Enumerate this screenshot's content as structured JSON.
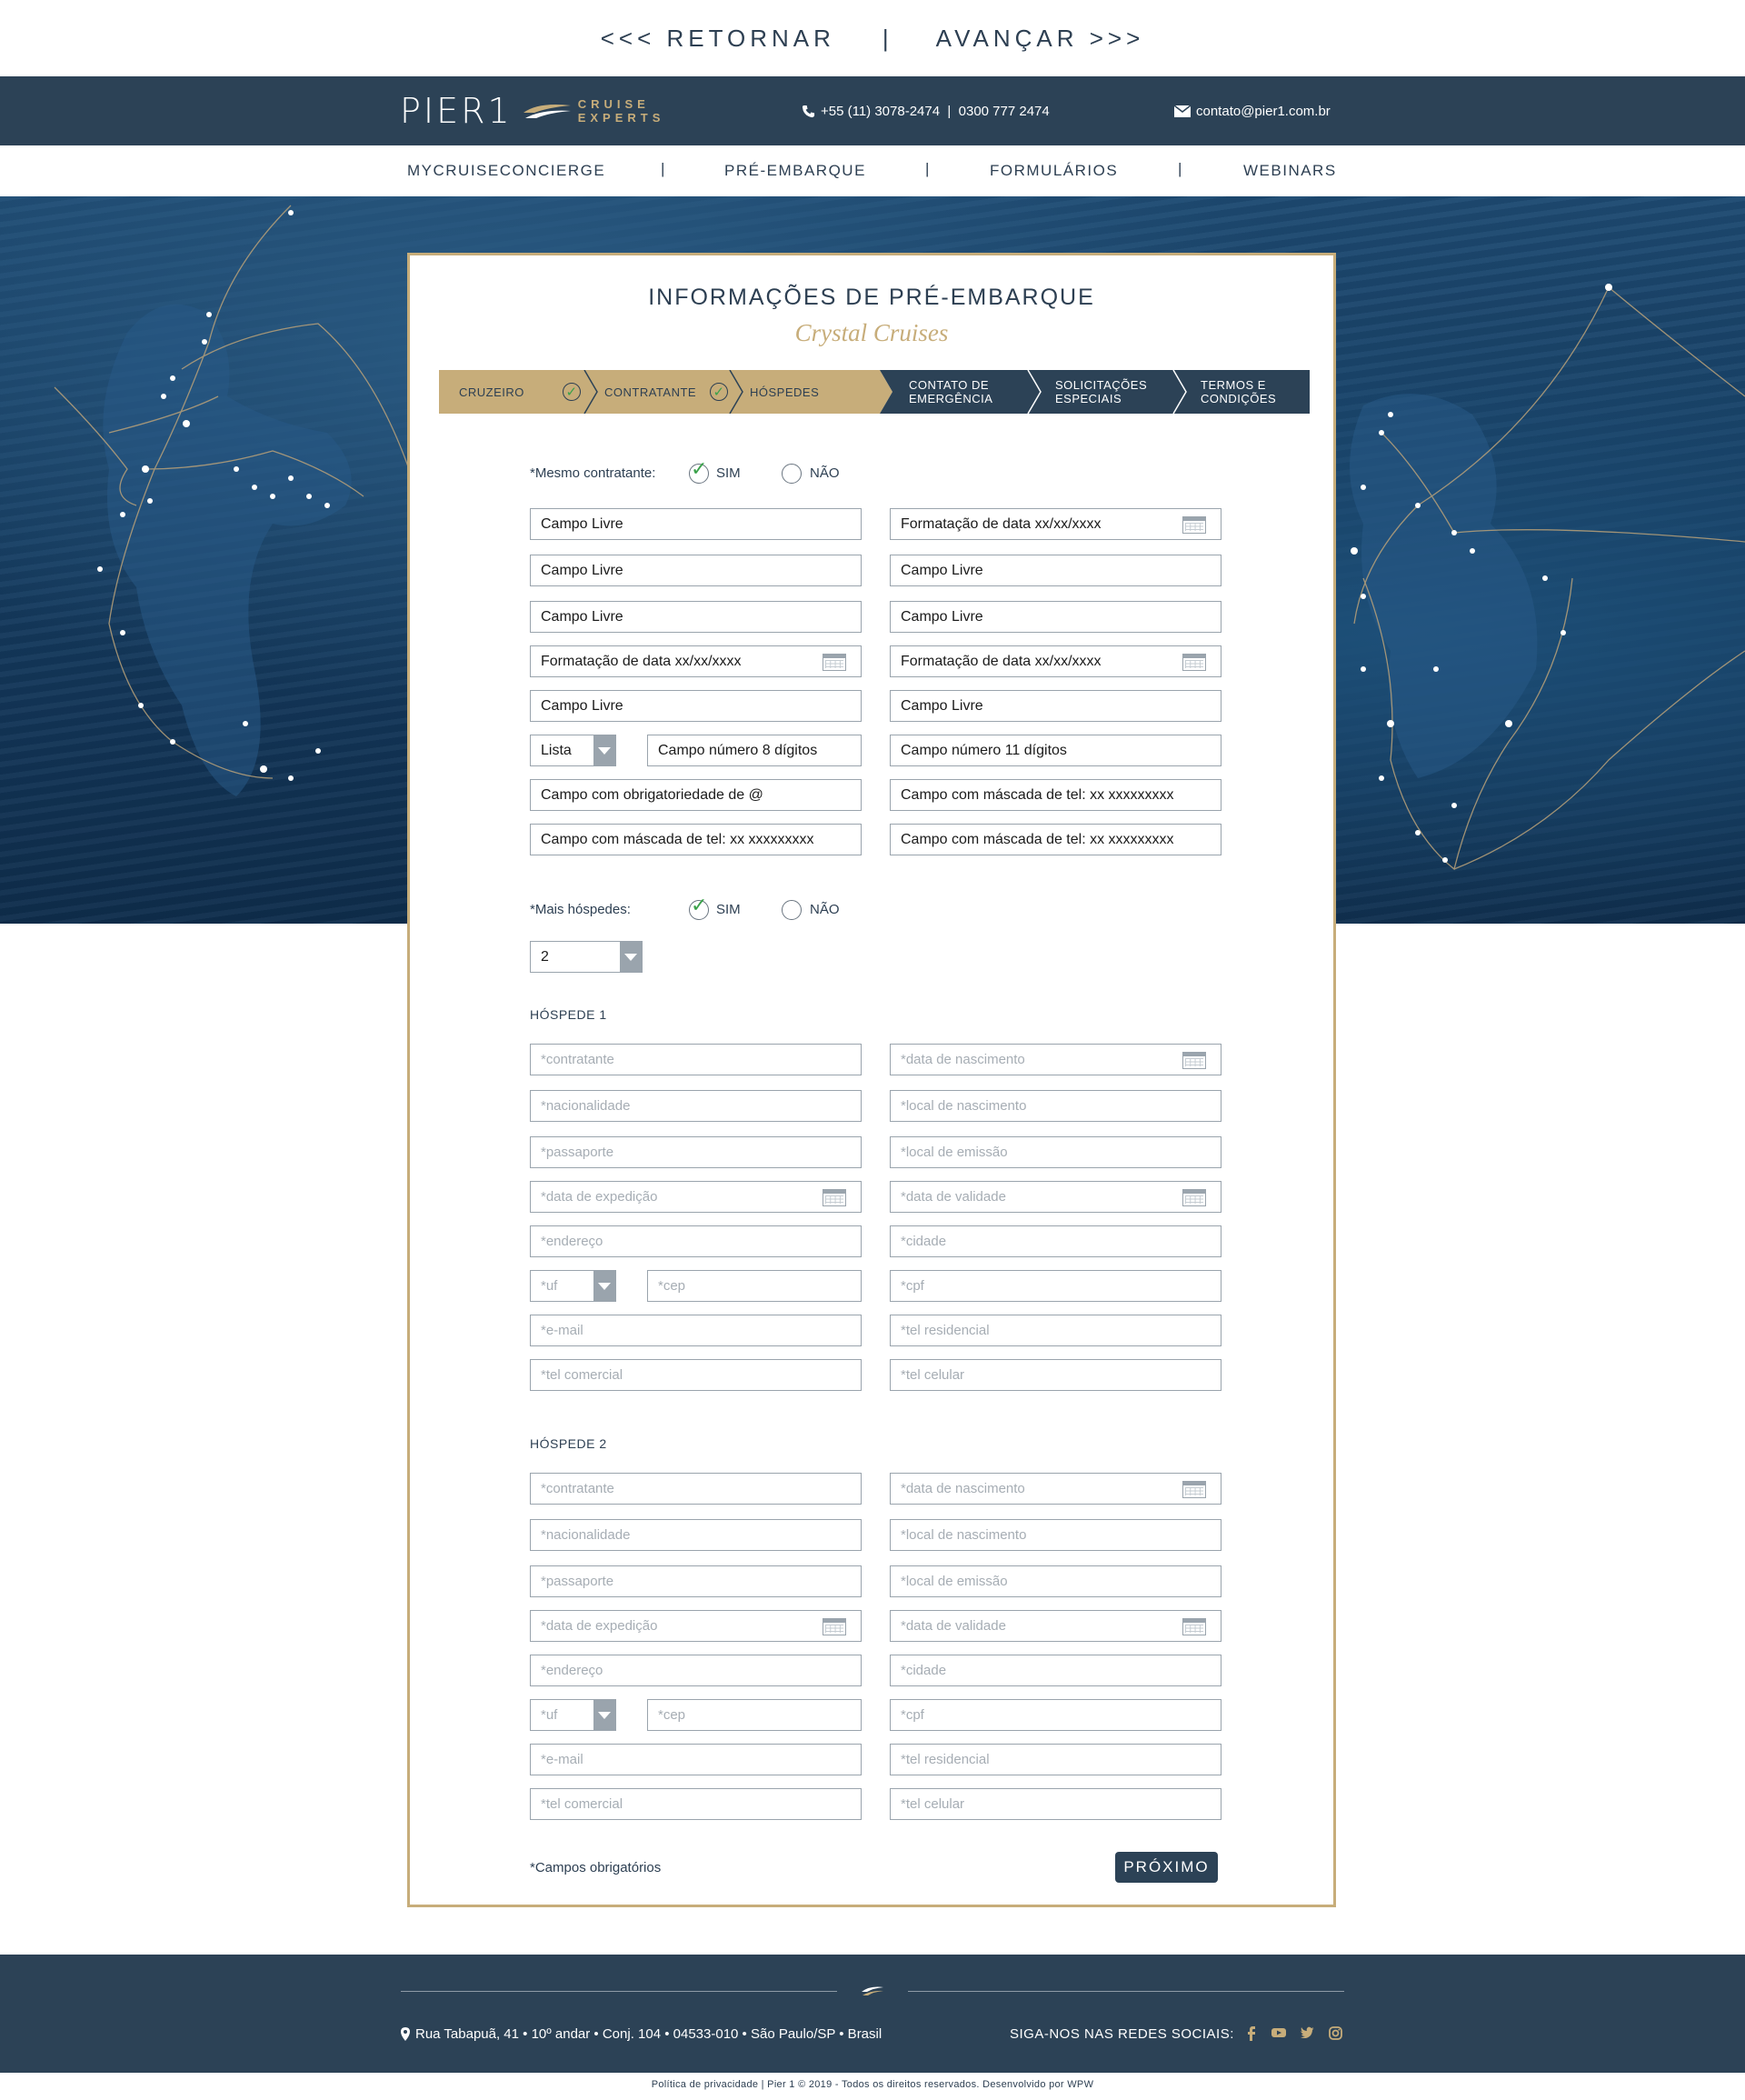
{
  "topnav": {
    "back": "<<< RETORNAR",
    "separator": "|",
    "forward": "AVANÇAR >>>"
  },
  "header": {
    "logo_text": "PIER1",
    "logo_sub1": "CRUISE",
    "logo_sub2": "EXPERTS",
    "phone": "+55 (11) 3078-2474  |  0300 777 2474",
    "email": "contato@pier1.com.br",
    "phone_icon": "phone-icon",
    "mail_icon": "mail-icon"
  },
  "menu": {
    "items": [
      "MYCRUISECONCIERGE",
      "PRÉ-EMBARQUE",
      "FORMULÁRIOS",
      "WEBINARS"
    ],
    "separator": "|"
  },
  "form": {
    "title": "INFORMAÇÕES DE PRÉ-EMBARQUE",
    "subtitle": "Crystal Cruises",
    "steps": [
      {
        "label": "CRUZEIRO",
        "done": true
      },
      {
        "label": "CONTRATANTE",
        "done": true
      },
      {
        "label": "HÓSPEDES",
        "done": false
      },
      {
        "label": "CONTATO DE EMERGÊNCIA",
        "done": false
      },
      {
        "label": "SOLICITAÇÕES ESPECIAIS",
        "done": false
      },
      {
        "label": "TERMOS E CONDIÇÕES",
        "done": false
      }
    ],
    "same_contractor": {
      "label": "*Mesmo contratante:",
      "yes": "SIM",
      "no": "NÃO",
      "selected": "SIM"
    },
    "contractor_fields": {
      "left": [
        "Campo Livre",
        "Campo Livre",
        "Campo Livre",
        "Formatação de data xx/xx/xxxx",
        "Campo Livre"
      ],
      "list": "Lista",
      "number8": "Campo número 8 dígitos",
      "email": "Campo com obrigatoriedade de @",
      "tel_left": "Campo com máscada de tel: xx xxxxxxxxx",
      "right": [
        "Formatação de data xx/xx/xxxx",
        "Campo Livre",
        "Campo Livre",
        "Formatação de data xx/xx/xxxx",
        "Campo Livre",
        "Campo número 11 dígitos",
        "Campo com máscada de tel: xx xxxxxxxxx",
        "Campo com máscada de tel: xx xxxxxxxxx"
      ]
    },
    "more_guests": {
      "label": "*Mais hóspedes:",
      "yes": "SIM",
      "no": "NÃO",
      "selected": "SIM"
    },
    "guest_count": "2",
    "guests": [
      {
        "heading": "HÓSPEDE 1",
        "left": [
          "*contratante",
          "*nacionalidade",
          "*passaporte",
          "*data de expedição",
          "*endereço"
        ],
        "uf": "*uf",
        "cep": "*cep",
        "left_bottom": [
          "*e-mail",
          "*tel comercial"
        ],
        "right": [
          "*data de nascimento",
          "*local de nascimento",
          "*local de emissão",
          "*data de validade",
          "*cidade",
          "*cpf",
          "*tel residencial",
          "*tel celular"
        ]
      },
      {
        "heading": "HÓSPEDE 2",
        "left": [
          "*contratante",
          "*nacionalidade",
          "*passaporte",
          "*data de expedição",
          "*endereço"
        ],
        "uf": "*uf",
        "cep": "*cep",
        "left_bottom": [
          "*e-mail",
          "*tel comercial"
        ],
        "right": [
          "*data de nascimento",
          "*local de nascimento",
          "*local de emissão",
          "*data de validade",
          "*cidade",
          "*cpf",
          "*tel residencial",
          "*tel celular"
        ]
      }
    ],
    "required_note": "*Campos obrigatórios",
    "next_button": "PRÓXIMO"
  },
  "footer": {
    "address": "Rua Tabapuã, 41 • 10º andar • Conj. 104 • 04533-010 • São Paulo/SP • Brasil",
    "social_label": "SIGA-NOS NAS REDES SOCIAIS:",
    "social_icons": [
      "facebook-icon",
      "youtube-icon",
      "twitter-icon",
      "instagram-icon"
    ],
    "copyright": "Política de privacidade | Pier 1 © 2019 - Todos os direitos reservados. Desenvolvido por WPW"
  },
  "colors": {
    "navy": "#2c4256",
    "gold": "#c7ad7a",
    "check_green": "#3aa14a"
  }
}
